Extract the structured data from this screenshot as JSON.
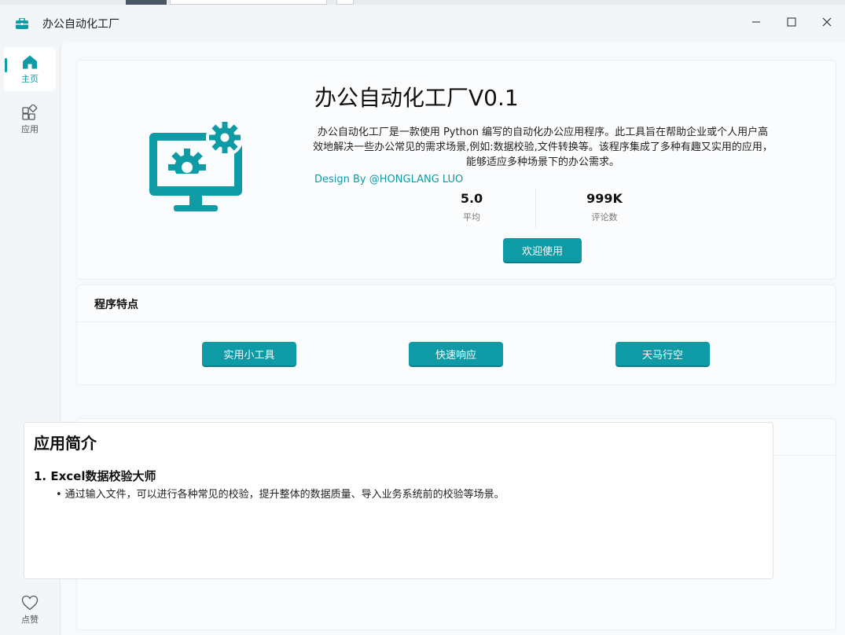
{
  "window": {
    "title": "办公自动化工厂"
  },
  "nav": {
    "items": [
      {
        "label": "主页",
        "icon": "home-icon",
        "active": true
      },
      {
        "label": "应用",
        "icon": "apps-icon",
        "active": false
      }
    ],
    "bottom": {
      "label": "点赞",
      "icon": "heart-icon"
    }
  },
  "hero": {
    "title": "办公自动化工厂V0.1",
    "description": "办公自动化工厂是一款使用 Python 编写的自动化办公应用程序。此工具旨在帮助企业或个人用户高效地解决一些办公常见的需求场景,例如:数据校验,文件转换等。该程序集成了多种有趣又实用的应用，能够适应多种场景下的办公需求。",
    "link": "Design By @HONGLANG LUO",
    "stats": [
      {
        "value": "5.0",
        "label": "平均"
      },
      {
        "value": "999K",
        "label": "评论数"
      }
    ],
    "cta": "欢迎使用"
  },
  "features": {
    "heading": "程序特点",
    "buttons": [
      "实用小工具",
      "快速响应",
      "天马行空"
    ]
  },
  "intro": {
    "heading": "应用简介",
    "sections": [
      {
        "title": "1. Excel数据校验大师",
        "bullets": [
          "通过输入文件，可以进行各种常见的校验，提升整体的数据质量、导入业务系统前的校验等场景。"
        ]
      }
    ]
  },
  "colors": {
    "accent": "#0e9ba5",
    "background": "#f3f6f9",
    "card": "#fbfcfd"
  }
}
